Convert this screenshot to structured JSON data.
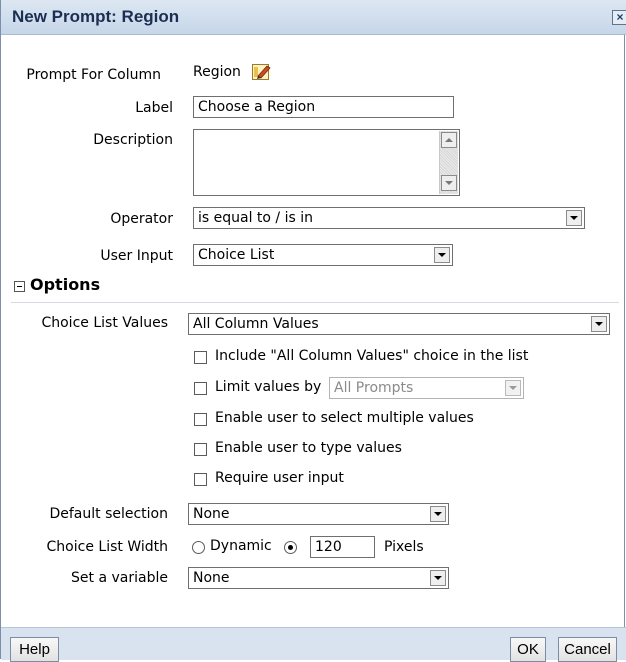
{
  "dialog": {
    "title": "New Prompt: Region",
    "close_icon": "close-icon"
  },
  "prompt_for_column": {
    "label": "Prompt For Column",
    "value": "Region",
    "icon": "edit-icon"
  },
  "label_field": {
    "label": "Label",
    "value": "Choose a Region"
  },
  "description_field": {
    "label": "Description",
    "value": ""
  },
  "operator": {
    "label": "Operator",
    "value": "is equal to / is in"
  },
  "user_input": {
    "label": "User Input",
    "value": "Choice List"
  },
  "options": {
    "title": "Options",
    "choice_list_values": {
      "label": "Choice List Values",
      "value": "All Column Values"
    },
    "include_all_column_values": {
      "label": "Include \"All Column Values\" choice in the list",
      "checked": false
    },
    "limit_values": {
      "label": "Limit values by",
      "checked": false,
      "value": "All Prompts"
    },
    "enable_multiple": {
      "label": "Enable user to select multiple values",
      "checked": false
    },
    "enable_type": {
      "label": "Enable user to type values",
      "checked": false
    },
    "require_input": {
      "label": "Require user input",
      "checked": false
    },
    "default_selection": {
      "label": "Default selection",
      "value": "None"
    },
    "choice_list_width": {
      "label": "Choice List Width",
      "dynamic_label": "Dynamic",
      "dynamic_selected": false,
      "fixed_selected": true,
      "value": "120",
      "unit": "Pixels"
    },
    "set_variable": {
      "label": "Set a variable",
      "value": "None"
    }
  },
  "footer": {
    "help_label": "Help",
    "ok_label": "OK",
    "cancel_label": "Cancel"
  }
}
